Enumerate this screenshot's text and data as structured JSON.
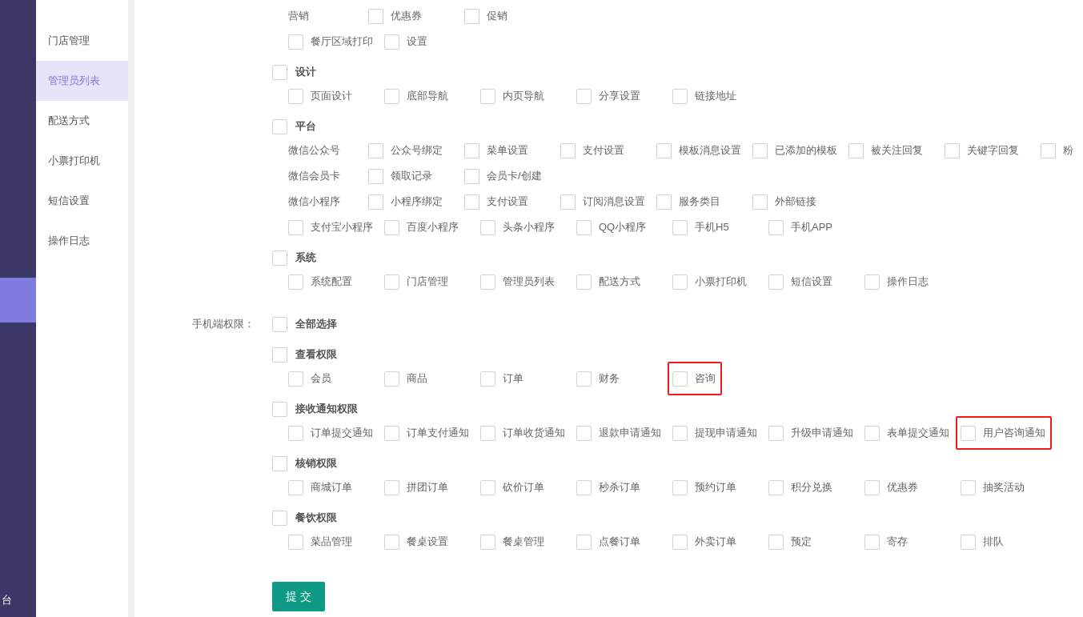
{
  "rail": {
    "active_block": true,
    "footer_text": "台"
  },
  "sidebar": {
    "items": [
      {
        "label": "门店管理",
        "selected": false
      },
      {
        "label": "管理员列表",
        "selected": true
      },
      {
        "label": "配送方式",
        "selected": false
      },
      {
        "label": "小票打印机",
        "selected": false
      },
      {
        "label": "短信设置",
        "selected": false
      },
      {
        "label": "操作日志",
        "selected": false
      }
    ]
  },
  "sections": [
    {
      "groups": [
        {
          "rows": [
            {
              "label": "营销",
              "items": [
                {
                  "label": "优惠券",
                  "checked": false
                },
                {
                  "label": "促销",
                  "checked": false
                }
              ]
            },
            {
              "items": [
                {
                  "label": "餐厅区域打印",
                  "checked": false
                },
                {
                  "label": "设置",
                  "checked": false
                }
              ]
            }
          ]
        },
        {
          "title": "设计",
          "checked": false,
          "rows": [
            {
              "items": [
                {
                  "label": "页面设计",
                  "checked": false
                },
                {
                  "label": "底部导航",
                  "checked": false
                },
                {
                  "label": "内页导航",
                  "checked": false
                },
                {
                  "label": "分享设置",
                  "checked": false
                },
                {
                  "label": "链接地址",
                  "checked": false
                }
              ]
            }
          ]
        },
        {
          "title": "平台",
          "checked": false,
          "rows": [
            {
              "label": "微信公众号",
              "items": [
                {
                  "label": "公众号绑定",
                  "checked": false
                },
                {
                  "label": "菜单设置",
                  "checked": false
                },
                {
                  "label": "支付设置",
                  "checked": false
                },
                {
                  "label": "模板消息设置",
                  "checked": false
                },
                {
                  "label": "已添加的模板",
                  "checked": false
                },
                {
                  "label": "被关注回复",
                  "checked": false
                },
                {
                  "label": "关键字回复",
                  "checked": false
                },
                {
                  "label": "粉",
                  "checked": false
                }
              ]
            },
            {
              "label": "微信会员卡",
              "items": [
                {
                  "label": "领取记录",
                  "checked": false
                },
                {
                  "label": "会员卡/创建",
                  "checked": false
                }
              ]
            },
            {
              "label": "微信小程序",
              "items": [
                {
                  "label": "小程序绑定",
                  "checked": false
                },
                {
                  "label": "支付设置",
                  "checked": false
                },
                {
                  "label": "订阅消息设置",
                  "checked": false
                },
                {
                  "label": "服务类目",
                  "checked": false
                },
                {
                  "label": "外部链接",
                  "checked": false
                }
              ]
            },
            {
              "items": [
                {
                  "label": "支付宝小程序",
                  "checked": false
                },
                {
                  "label": "百度小程序",
                  "checked": false
                },
                {
                  "label": "头条小程序",
                  "checked": false
                },
                {
                  "label": "QQ小程序",
                  "checked": false
                },
                {
                  "label": "手机H5",
                  "checked": false
                },
                {
                  "label": "手机APP",
                  "checked": false
                }
              ]
            }
          ]
        },
        {
          "title": "系统",
          "checked": false,
          "rows": [
            {
              "items": [
                {
                  "label": "系统配置",
                  "checked": false
                },
                {
                  "label": "门店管理",
                  "checked": false
                },
                {
                  "label": "管理员列表",
                  "checked": false
                },
                {
                  "label": "配送方式",
                  "checked": false
                },
                {
                  "label": "小票打印机",
                  "checked": false
                },
                {
                  "label": "短信设置",
                  "checked": false
                },
                {
                  "label": "操作日志",
                  "checked": false
                }
              ]
            }
          ]
        }
      ]
    },
    {
      "label": "手机端权限：",
      "select_all": {
        "label": "全部选择",
        "checked": false
      },
      "groups": [
        {
          "title": "查看权限",
          "checked": false,
          "rows": [
            {
              "items": [
                {
                  "label": "会员",
                  "checked": false,
                  "highlighted": false
                },
                {
                  "label": "商品",
                  "checked": false,
                  "highlighted": false
                },
                {
                  "label": "订单",
                  "checked": false,
                  "highlighted": false
                },
                {
                  "label": "财务",
                  "checked": false,
                  "highlighted": false
                },
                {
                  "label": "咨询",
                  "checked": false,
                  "highlighted": true
                }
              ]
            }
          ]
        },
        {
          "title": "接收通知权限",
          "checked": false,
          "rows": [
            {
              "items": [
                {
                  "label": "订单提交通知",
                  "checked": false,
                  "highlighted": false
                },
                {
                  "label": "订单支付通知",
                  "checked": false,
                  "highlighted": false
                },
                {
                  "label": "订单收货通知",
                  "checked": false,
                  "highlighted": false
                },
                {
                  "label": "退款申请通知",
                  "checked": false,
                  "highlighted": false
                },
                {
                  "label": "提现申请通知",
                  "checked": false,
                  "highlighted": false
                },
                {
                  "label": "升级申请通知",
                  "checked": false,
                  "highlighted": false
                },
                {
                  "label": "表单提交通知",
                  "checked": false,
                  "highlighted": false
                },
                {
                  "label": "用户咨询通知",
                  "checked": false,
                  "highlighted": true
                }
              ]
            }
          ]
        },
        {
          "title": "核销权限",
          "checked": false,
          "rows": [
            {
              "items": [
                {
                  "label": "商城订单",
                  "checked": false
                },
                {
                  "label": "拼团订单",
                  "checked": false
                },
                {
                  "label": "砍价订单",
                  "checked": false
                },
                {
                  "label": "秒杀订单",
                  "checked": false
                },
                {
                  "label": "预约订单",
                  "checked": false
                },
                {
                  "label": "积分兑换",
                  "checked": false
                },
                {
                  "label": "优惠券",
                  "checked": false
                },
                {
                  "label": "抽奖活动",
                  "checked": false
                }
              ]
            }
          ]
        },
        {
          "title": "餐饮权限",
          "checked": false,
          "rows": [
            {
              "items": [
                {
                  "label": "菜品管理",
                  "checked": false
                },
                {
                  "label": "餐桌设置",
                  "checked": false
                },
                {
                  "label": "餐桌管理",
                  "checked": false
                },
                {
                  "label": "点餐订单",
                  "checked": false
                },
                {
                  "label": "外卖订单",
                  "checked": false
                },
                {
                  "label": "预定",
                  "checked": false
                },
                {
                  "label": "寄存",
                  "checked": false
                },
                {
                  "label": "排队",
                  "checked": false
                }
              ]
            }
          ]
        }
      ]
    }
  ],
  "submit_button": "提 交"
}
